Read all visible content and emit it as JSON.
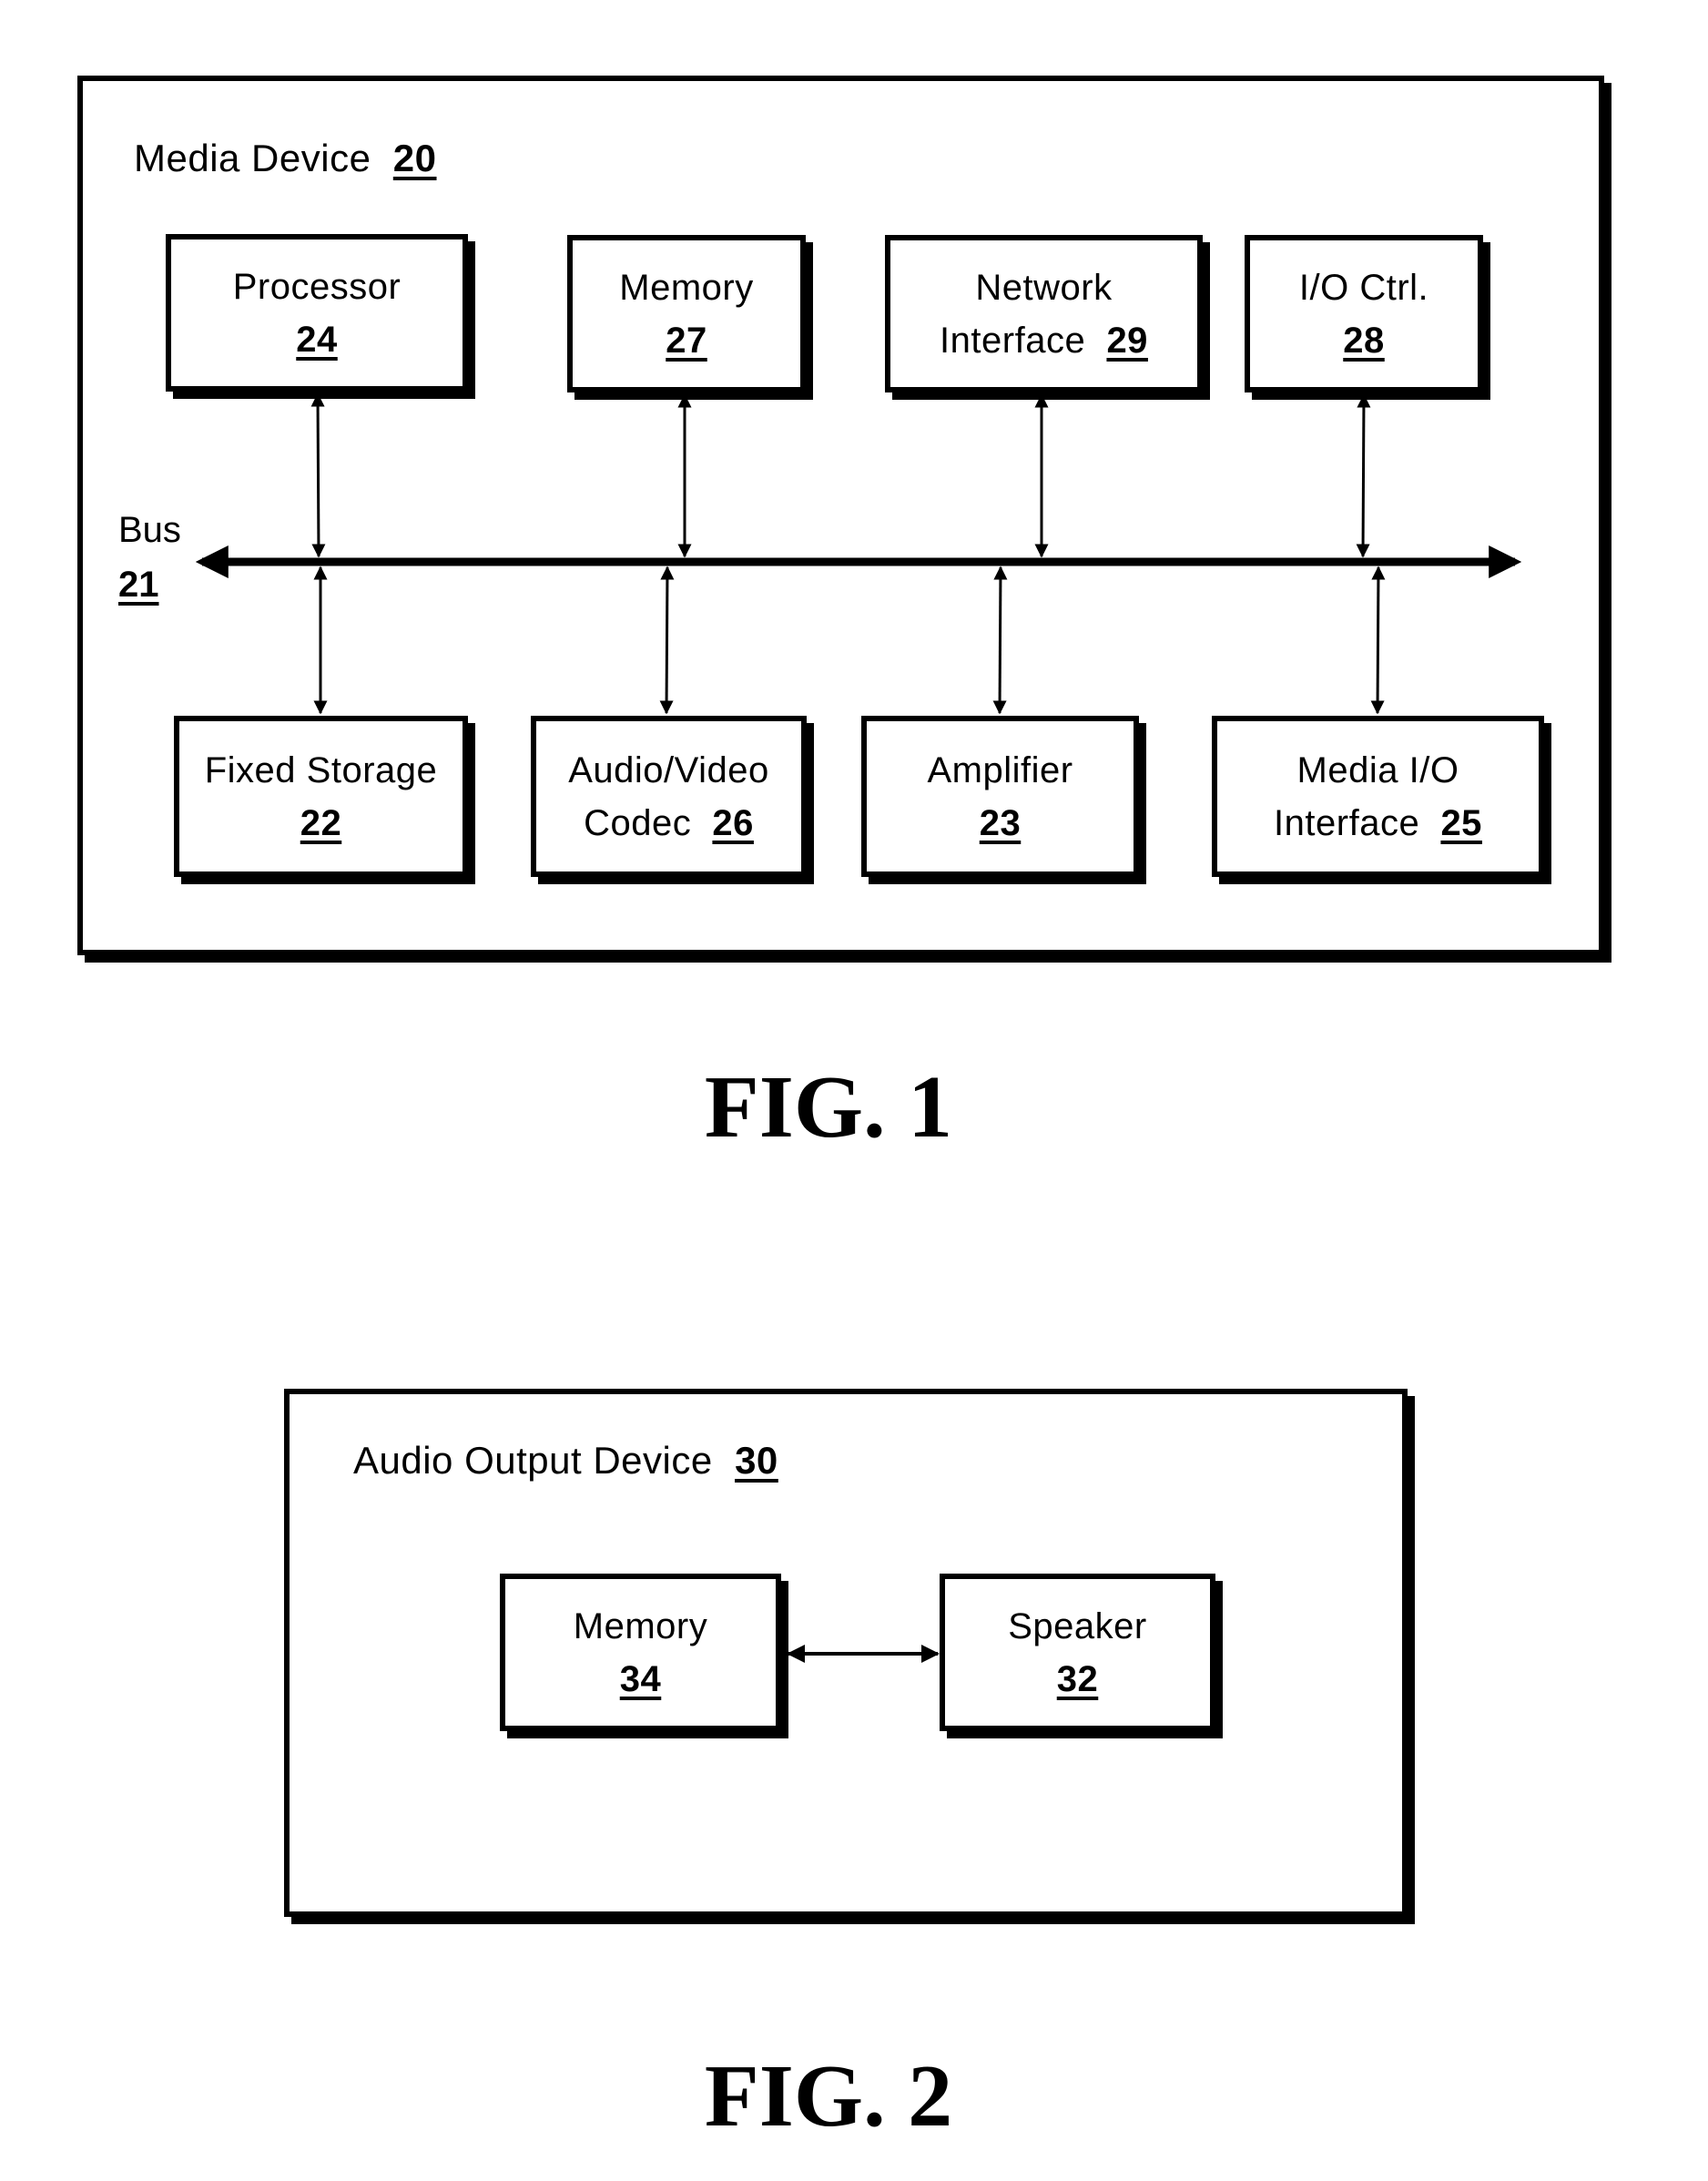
{
  "fig1": {
    "caption": "FIG. 1",
    "container": {
      "label": "Media Device",
      "ref": "20"
    },
    "bus": {
      "label": "Bus",
      "ref": "21"
    },
    "top_blocks": [
      {
        "id": "processor",
        "lines": [
          "Processor"
        ],
        "ref": "24"
      },
      {
        "id": "memory",
        "lines": [
          "Memory"
        ],
        "ref": "27"
      },
      {
        "id": "network-interface",
        "lines": [
          "Network",
          "Interface"
        ],
        "ref": "29"
      },
      {
        "id": "io-ctrl",
        "lines": [
          "I/O Ctrl."
        ],
        "ref": "28"
      }
    ],
    "bottom_blocks": [
      {
        "id": "fixed-storage",
        "lines": [
          "Fixed Storage"
        ],
        "ref": "22"
      },
      {
        "id": "audio-video-codec",
        "lines": [
          "Audio/Video",
          "Codec"
        ],
        "ref": "26"
      },
      {
        "id": "amplifier",
        "lines": [
          "Amplifier"
        ],
        "ref": "23"
      },
      {
        "id": "media-io-interface",
        "lines": [
          "Media I/O",
          "Interface"
        ],
        "ref": "25"
      }
    ],
    "connections": "Each block connects bidirectionally to Bus 21"
  },
  "fig2": {
    "caption": "FIG. 2",
    "container": {
      "label": "Audio Output Device",
      "ref": "30"
    },
    "blocks": [
      {
        "id": "memory",
        "lines": [
          "Memory"
        ],
        "ref": "34"
      },
      {
        "id": "speaker",
        "lines": [
          "Speaker"
        ],
        "ref": "32"
      }
    ],
    "connections": "Memory 34 connects bidirectionally to Speaker 32"
  }
}
